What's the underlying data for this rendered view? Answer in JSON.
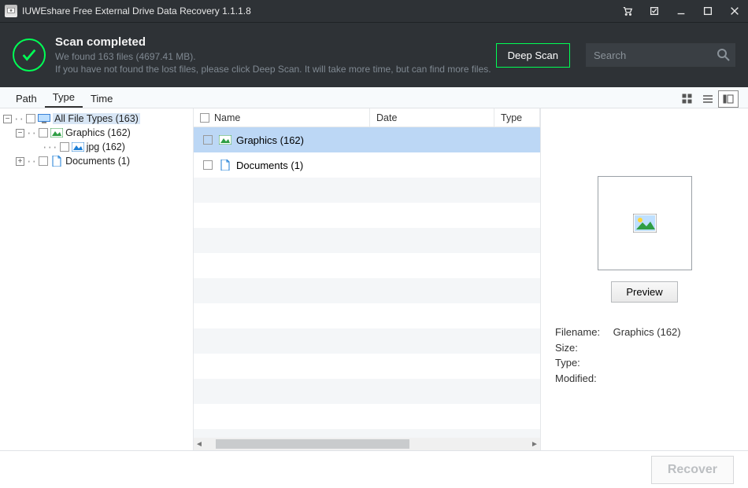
{
  "title": "IUWEshare Free External Drive Data Recovery 1.1.1.8",
  "status": {
    "heading": "Scan completed",
    "line1": "We found 163 files (4697.41 MB).",
    "line2": "If you have not found the lost files, please click Deep Scan. It will take more time, but can find more files."
  },
  "deep_scan_label": "Deep Scan",
  "search_placeholder": "Search",
  "tabs": {
    "path": "Path",
    "type": "Type",
    "time": "Time"
  },
  "tree": {
    "root": "All File Types (163)",
    "graphics": "Graphics (162)",
    "jpg": "jpg (162)",
    "documents": "Documents (1)"
  },
  "columns": {
    "name": "Name",
    "date": "Date",
    "type": "Type"
  },
  "rows": {
    "graphics": "Graphics (162)",
    "documents": "Documents (1)"
  },
  "preview": {
    "button": "Preview",
    "filename_label": "Filename:",
    "filename_value": "Graphics (162)",
    "size_label": "Size:",
    "type_label": "Type:",
    "modified_label": "Modified:"
  },
  "recover_label": "Recover"
}
